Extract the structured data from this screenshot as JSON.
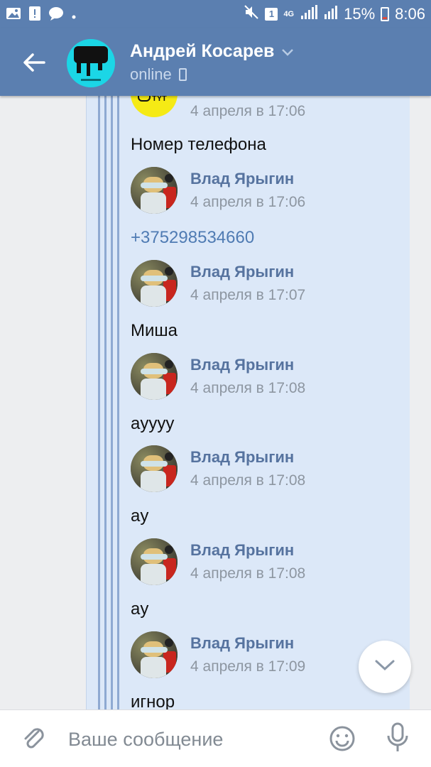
{
  "status_bar": {
    "battery": "15%",
    "time": "8:06",
    "sim": "1",
    "network": "4G"
  },
  "header": {
    "contact_name": "Андрей Косарев",
    "status": "online"
  },
  "chat": {
    "top_date": "4 апреля в 17:06",
    "first_text": "Номер телефона",
    "messages": [
      {
        "sender": "Влад Ярыгин",
        "date": "4 апреля в 17:06",
        "text": "+375298534660",
        "is_link": true
      },
      {
        "sender": "Влад Ярыгин",
        "date": "4 апреля в 17:07",
        "text": "Миша"
      },
      {
        "sender": "Влад Ярыгин",
        "date": "4 апреля в 17:08",
        "text": "ayyyy"
      },
      {
        "sender": "Влад Ярыгин",
        "date": "4 апреля в 17:08",
        "text": "ay"
      },
      {
        "sender": "Влад Ярыгин",
        "date": "4 апреля в 17:08",
        "text": "ay"
      },
      {
        "sender": "Влад Ярыгин",
        "date": "4 апреля в 17:09",
        "text": "игнор"
      }
    ]
  },
  "input": {
    "placeholder": "Ваше сообщение"
  },
  "icons": {
    "back": "arrow-left-icon",
    "attach": "paperclip-icon",
    "emoji": "smile-icon",
    "mic": "microphone-icon",
    "scroll": "chevron-down-icon"
  },
  "colors": {
    "header": "#5b7fb0",
    "bubble": "#dce8f8",
    "sender": "#56739f",
    "link": "#4f7bb3"
  }
}
